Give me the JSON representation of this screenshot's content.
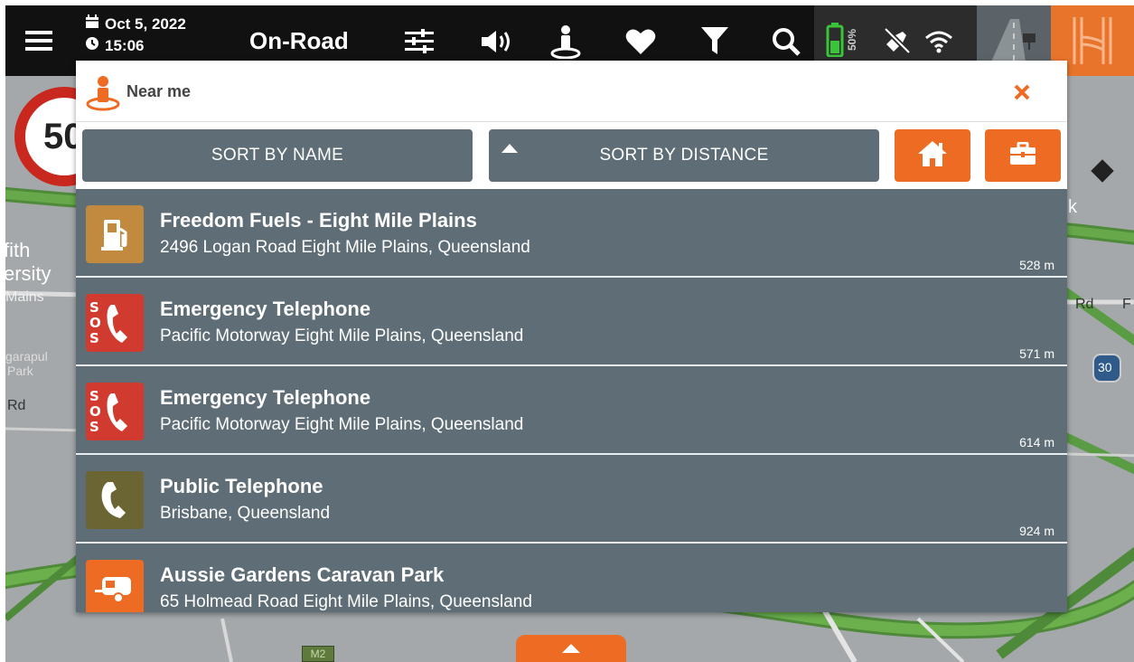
{
  "topbar": {
    "date": "Oct 5, 2022",
    "time": "15:06",
    "mode": "On-Road",
    "battery_percent": "50%",
    "icons": [
      "menu-icon",
      "calendar-icon",
      "clock-icon",
      "sliders-icon",
      "volume-icon",
      "near-me-icon",
      "heart-icon",
      "filter-icon",
      "search-icon",
      "battery-icon",
      "gps-off-icon",
      "wifi-icon",
      "road-view-icon",
      "app-logo"
    ]
  },
  "speed_limit": "50",
  "map_labels": {
    "l1": "fith",
    "l2": "ersity",
    "l3": "Mains",
    "l4": "garapul",
    "l5": "Park",
    "l6": "Rd",
    "l7": "k",
    "l8": "Rd",
    "l9": "F",
    "route_shield": "30",
    "m2": "M2"
  },
  "dialog": {
    "title": "Near me",
    "sort_name_label": "SORT BY NAME",
    "sort_distance_label": "SORT BY DISTANCE",
    "close_icon": "close-icon",
    "home_icon": "home-icon",
    "work_icon": "briefcase-icon"
  },
  "pois": [
    {
      "name": "Freedom Fuels - Eight Mile Plains",
      "address": "2496 Logan Road Eight Mile Plains, Queensland",
      "distance": "528 m",
      "icon": "fuel-icon",
      "icon_color": "#c18a3e"
    },
    {
      "name": "Emergency Telephone",
      "address": "Pacific Motorway Eight Mile Plains, Queensland",
      "distance": "571 m",
      "icon": "sos-phone-icon",
      "icon_color": "#d13a2f"
    },
    {
      "name": "Emergency Telephone",
      "address": "Pacific Motorway Eight Mile Plains, Queensland",
      "distance": "614 m",
      "icon": "sos-phone-icon",
      "icon_color": "#d13a2f"
    },
    {
      "name": "Public Telephone",
      "address": "Brisbane, Queensland",
      "distance": "924 m",
      "icon": "phone-icon",
      "icon_color": "#6b6533"
    },
    {
      "name": "Aussie Gardens Caravan Park",
      "address": "65 Holmead Road Eight Mile Plains, Queensland",
      "distance": "",
      "icon": "caravan-icon",
      "icon_color": "#ed6b22"
    }
  ],
  "colors": {
    "accent": "#ed6b22",
    "list_bg": "#5f6e76",
    "topbar": "#111111"
  }
}
